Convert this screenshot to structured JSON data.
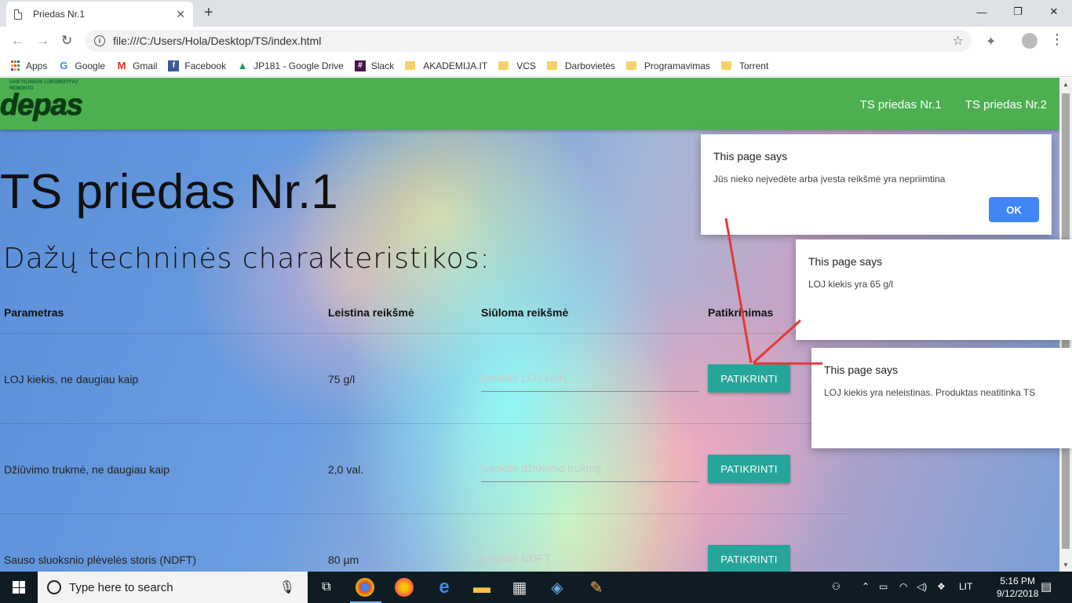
{
  "browser": {
    "tab_title": "Priedas Nr.1",
    "tab_close": "✕",
    "new_tab": "+",
    "url": "file:///C:/Users/Hola/Desktop/TS/index.html",
    "bookmarks": [
      "Apps",
      "Google",
      "Gmail",
      "Facebook",
      "JP181 - Google Drive",
      "Slack",
      "AKADEMIJA.IT",
      "VCS",
      "Darbovietės",
      "Programavimas",
      "Torrent"
    ]
  },
  "site": {
    "logo_small": "UAB VILNIAUS LOKOMOTYVŲ REMONTO",
    "logo_big": "depas",
    "nav": [
      "TS priedas Nr.1",
      "TS priedas Nr.2"
    ],
    "title": "TS priedas Nr.1",
    "subtitle": "Dažų techninės charakteristikos:",
    "table": {
      "headers": [
        "Parametras",
        "Leistina reikšmė",
        "Siūloma reikšmė",
        "Patikrinimas"
      ],
      "rows": [
        {
          "param": "LOJ kiekis, ne daugiau kaip",
          "allowed": "75 g/l",
          "placeholder": "Įveskite LOJ kiekį",
          "button": "PATIKRINTI"
        },
        {
          "param": "Džiūvimo trukmė, ne daugiau kaip",
          "allowed": "2,0 val.",
          "placeholder": "Įveskite džiuvimo trukmę",
          "button": "PATIKRINTI"
        },
        {
          "param": "Sauso sluoksnio plėvelės storis (NDFT)",
          "allowed": "80 µm",
          "placeholder": "Įveskite NDFT",
          "button": "PATIKRINTI"
        }
      ]
    }
  },
  "dialogs": [
    {
      "title": "This page says",
      "message": "Jūs nieko neįvedėte arba įvesta reikšmė yra nepriimtina",
      "ok": "OK"
    },
    {
      "title": "This page says",
      "message": "LOJ kiekis yra 65 g/l"
    },
    {
      "title": "This page says",
      "message": "LOJ kiekis yra neleistinas. Produktas neatitinka TS"
    }
  ],
  "taskbar": {
    "search_placeholder": "Type here to search",
    "language": "LIT",
    "time": "5:16 PM",
    "date": "9/12/2018"
  },
  "colors": {
    "navbar": "#4caf50",
    "button": "#26a69a",
    "ok_button": "#4285f4",
    "annotation_arrow": "#e53935"
  }
}
